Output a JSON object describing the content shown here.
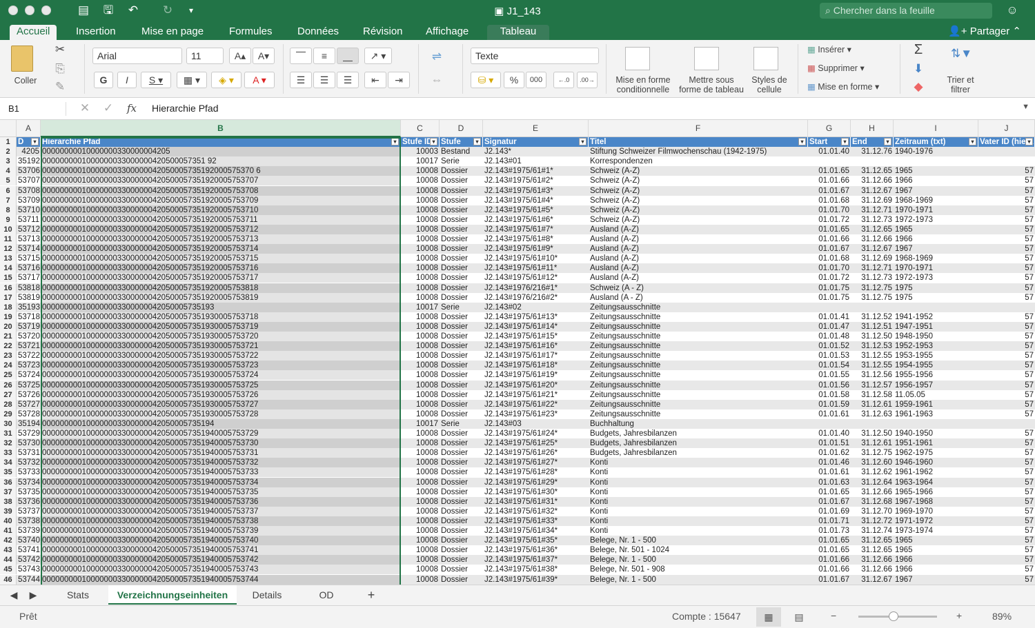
{
  "window": {
    "title": "J1_143",
    "search_placeholder": "Chercher dans la feuille"
  },
  "ribbon_tabs": [
    "Accueil",
    "Insertion",
    "Mise en page",
    "Formules",
    "Données",
    "Révision",
    "Affichage",
    "Tableau"
  ],
  "share_label": "Partager",
  "ribbon": {
    "paste": "Coller",
    "font": "Arial",
    "size": "11",
    "number_format": "Texte",
    "conditional": [
      "Mise en forme",
      "conditionnelle"
    ],
    "table_format": [
      "Mettre sous",
      "forme de tableau"
    ],
    "cell_styles": [
      "Styles de",
      "cellule"
    ],
    "insert": "Insérer",
    "delete": "Supprimer",
    "format": "Mise en forme",
    "sort": [
      "Trier et",
      "filtrer"
    ]
  },
  "formula_bar": {
    "cell_ref": "B1",
    "fx": "fx",
    "value": "Hierarchie Pfad"
  },
  "columns": [
    "A",
    "B",
    "C",
    "D",
    "E",
    "F",
    "G",
    "H",
    "I",
    "J"
  ],
  "headers": [
    "D",
    "Hierarchie Pfad",
    "Stufe ID",
    "Stufe",
    "Signatur",
    "Titel",
    "Start",
    "End",
    "Zeitraum (txt)",
    "Vater ID (hiera"
  ],
  "rows": [
    [
      "4205",
      "00000000010000000330000004205",
      "10003",
      "Bestand",
      "J2.143*",
      "Stiftung Schweizer Filmwochenschau (1942-1975)",
      "01.01.40",
      "31.12.76",
      "1940-1976",
      ""
    ],
    [
      "35192",
      "0000000001000000033000000420500057351 92",
      "10017",
      "Serie",
      "J2.143#01",
      "Korrespondenzen",
      "",
      "",
      "",
      ""
    ],
    [
      "53706",
      "000000000100000003300000042050005735192000575370 6",
      "10008",
      "Dossier",
      "J2.143#1975/61#1*",
      "Schweiz (A-Z)",
      "01.01.65",
      "31.12.65",
      "1965",
      "57"
    ],
    [
      "53707",
      "0000000001000000033000000420500057351920005753707",
      "10008",
      "Dossier",
      "J2.143#1975/61#2*",
      "Schweiz (A-Z)",
      "01.01.66",
      "31.12.66",
      "1966",
      "57"
    ],
    [
      "53708",
      "0000000001000000033000000420500057351920005753708",
      "10008",
      "Dossier",
      "J2.143#1975/61#3*",
      "Schweiz (A-Z)",
      "01.01.67",
      "31.12.67",
      "1967",
      "57"
    ],
    [
      "53709",
      "0000000001000000033000000420500057351920005753709",
      "10008",
      "Dossier",
      "J2.143#1975/61#4*",
      "Schweiz (A-Z)",
      "01.01.68",
      "31.12.69",
      "1968-1969",
      "57"
    ],
    [
      "53710",
      "0000000001000000033000000420500057351920005753710",
      "10008",
      "Dossier",
      "J2.143#1975/61#5*",
      "Schweiz (A-Z)",
      "01.01.70",
      "31.12.71",
      "1970-1971",
      "57"
    ],
    [
      "53711",
      "0000000001000000033000000420500057351920005753711",
      "10008",
      "Dossier",
      "J2.143#1975/61#6*",
      "Schweiz (A-Z)",
      "01.01.72",
      "31.12.73",
      "1972-1973",
      "57"
    ],
    [
      "53712",
      "0000000001000000033000000420500057351920005753712",
      "10008",
      "Dossier",
      "J2.143#1975/61#7*",
      "Ausland (A-Z)",
      "01.01.65",
      "31.12.65",
      "1965",
      "57"
    ],
    [
      "53713",
      "0000000001000000033000000420500057351920005753713",
      "10008",
      "Dossier",
      "J2.143#1975/61#8*",
      "Ausland (A-Z)",
      "01.01.66",
      "31.12.66",
      "1966",
      "57"
    ],
    [
      "53714",
      "0000000001000000033000000420500057351920005753714",
      "10008",
      "Dossier",
      "J2.143#1975/61#9*",
      "Ausland (A-Z)",
      "01.01.67",
      "31.12.67",
      "1967",
      "57"
    ],
    [
      "53715",
      "0000000001000000033000000420500057351920005753715",
      "10008",
      "Dossier",
      "J2.143#1975/61#10*",
      "Ausland (A-Z)",
      "01.01.68",
      "31.12.69",
      "1968-1969",
      "57"
    ],
    [
      "53716",
      "0000000001000000033000000420500057351920005753716",
      "10008",
      "Dossier",
      "J2.143#1975/61#11*",
      "Ausland (A-Z)",
      "01.01.70",
      "31.12.71",
      "1970-1971",
      "57"
    ],
    [
      "53717",
      "0000000001000000033000000420500057351920005753717",
      "10008",
      "Dossier",
      "J2.143#1975/61#12*",
      "Ausland (A-Z)",
      "01.01.72",
      "31.12.73",
      "1972-1973",
      "57"
    ],
    [
      "53818",
      "0000000001000000033000000420500057351920005753818",
      "10008",
      "Dossier",
      "J2.143#1976/216#1*",
      "Schweiz (A - Z)",
      "01.01.75",
      "31.12.75",
      "1975",
      "57"
    ],
    [
      "53819",
      "0000000001000000033000000420500057351920005753819",
      "10008",
      "Dossier",
      "J2.143#1976/216#2*",
      "Ausland (A - Z)",
      "01.01.75",
      "31.12.75",
      "1975",
      "57"
    ],
    [
      "35193",
      "000000000100000003300000042050005735193",
      "10017",
      "Serie",
      "J2.143#02",
      "Zeitungsausschnitte",
      "",
      "",
      "",
      ""
    ],
    [
      "53718",
      "0000000001000000033000000420500057351930005753718",
      "10008",
      "Dossier",
      "J2.143#1975/61#13*",
      "Zeitungsausschnitte",
      "01.01.41",
      "31.12.52",
      "1941-1952",
      "57"
    ],
    [
      "53719",
      "0000000001000000033000000420500057351930005753719",
      "10008",
      "Dossier",
      "J2.143#1975/61#14*",
      "Zeitungsausschnitte",
      "01.01.47",
      "31.12.51",
      "1947-1951",
      "57"
    ],
    [
      "53720",
      "0000000001000000033000000420500057351930005753720",
      "10008",
      "Dossier",
      "J2.143#1975/61#15*",
      "Zeitungsausschnitte",
      "01.01.48",
      "31.12.50",
      "1948-1950",
      "57"
    ],
    [
      "53721",
      "0000000001000000033000000420500057351930005753721",
      "10008",
      "Dossier",
      "J2.143#1975/61#16*",
      "Zeitungsausschnitte",
      "01.01.52",
      "31.12.53",
      "1952-1953",
      "57"
    ],
    [
      "53722",
      "0000000001000000033000000420500057351930005753722",
      "10008",
      "Dossier",
      "J2.143#1975/61#17*",
      "Zeitungsausschnitte",
      "01.01.53",
      "31.12.55",
      "1953-1955",
      "57"
    ],
    [
      "53723",
      "0000000001000000033000000420500057351930005753723",
      "10008",
      "Dossier",
      "J2.143#1975/61#18*",
      "Zeitungsausschnitte",
      "01.01.54",
      "31.12.55",
      "1954-1955",
      "57"
    ],
    [
      "53724",
      "0000000001000000033000000420500057351930005753724",
      "10008",
      "Dossier",
      "J2.143#1975/61#19*",
      "Zeitungsausschnitte",
      "01.01.55",
      "31.12.56",
      "1955-1956",
      "57"
    ],
    [
      "53725",
      "0000000001000000033000000420500057351930005753725",
      "10008",
      "Dossier",
      "J2.143#1975/61#20*",
      "Zeitungsausschnitte",
      "01.01.56",
      "31.12.57",
      "1956-1957",
      "57"
    ],
    [
      "53726",
      "0000000001000000033000000420500057351930005753726",
      "10008",
      "Dossier",
      "J2.143#1975/61#21*",
      "Zeitungsausschnitte",
      "01.01.58",
      "31.12.58",
      "11.05.05",
      "57"
    ],
    [
      "53727",
      "0000000001000000033000000420500057351930005753727",
      "10008",
      "Dossier",
      "J2.143#1975/61#22*",
      "Zeitungsausschnitte",
      "01.01.59",
      "31.12.61",
      "1959-1961",
      "57"
    ],
    [
      "53728",
      "0000000001000000033000000420500057351930005753728",
      "10008",
      "Dossier",
      "J2.143#1975/61#23*",
      "Zeitungsausschnitte",
      "01.01.61",
      "31.12.63",
      "1961-1963",
      "57"
    ],
    [
      "35194",
      "000000000100000003300000042050005735194",
      "10017",
      "Serie",
      "J2.143#03",
      "Buchhaltung",
      "",
      "",
      "",
      ""
    ],
    [
      "53729",
      "0000000001000000033000000420500057351940005753729",
      "10008",
      "Dossier",
      "J2.143#1975/61#24*",
      "Budgets, Jahresbilanzen",
      "01.01.40",
      "31.12.50",
      "1940-1950",
      "57"
    ],
    [
      "53730",
      "0000000001000000033000000420500057351940005753730",
      "10008",
      "Dossier",
      "J2.143#1975/61#25*",
      "Budgets, Jahresbilanzen",
      "01.01.51",
      "31.12.61",
      "1951-1961",
      "57"
    ],
    [
      "53731",
      "0000000001000000033000000420500057351940005753731",
      "10008",
      "Dossier",
      "J2.143#1975/61#26*",
      "Budgets, Jahresbilanzen",
      "01.01.62",
      "31.12.75",
      "1962-1975",
      "57"
    ],
    [
      "53732",
      "0000000001000000033000000420500057351940005753732",
      "10008",
      "Dossier",
      "J2.143#1975/61#27*",
      "Konti",
      "01.01.46",
      "31.12.60",
      "1946-1960",
      "57"
    ],
    [
      "53733",
      "0000000001000000033000000420500057351940005753733",
      "10008",
      "Dossier",
      "J2.143#1975/61#28*",
      "Konti",
      "01.01.61",
      "31.12.62",
      "1961-1962",
      "57"
    ],
    [
      "53734",
      "0000000001000000033000000420500057351940005753734",
      "10008",
      "Dossier",
      "J2.143#1975/61#29*",
      "Konti",
      "01.01.63",
      "31.12.64",
      "1963-1964",
      "57"
    ],
    [
      "53735",
      "0000000001000000033000000420500057351940005753735",
      "10008",
      "Dossier",
      "J2.143#1975/61#30*",
      "Konti",
      "01.01.65",
      "31.12.66",
      "1965-1966",
      "57"
    ],
    [
      "53736",
      "0000000001000000033000000420500057351940005753736",
      "10008",
      "Dossier",
      "J2.143#1975/61#31*",
      "Konti",
      "01.01.67",
      "31.12.68",
      "1967-1968",
      "57"
    ],
    [
      "53737",
      "0000000001000000033000000420500057351940005753737",
      "10008",
      "Dossier",
      "J2.143#1975/61#32*",
      "Konti",
      "01.01.69",
      "31.12.70",
      "1969-1970",
      "57"
    ],
    [
      "53738",
      "0000000001000000033000000420500057351940005753738",
      "10008",
      "Dossier",
      "J2.143#1975/61#33*",
      "Konti",
      "01.01.71",
      "31.12.72",
      "1971-1972",
      "57"
    ],
    [
      "53739",
      "0000000001000000033000000420500057351940005753739",
      "10008",
      "Dossier",
      "J2.143#1975/61#34*",
      "Konti",
      "01.01.73",
      "31.12.74",
      "1973-1974",
      "57"
    ],
    [
      "53740",
      "0000000001000000033000000420500057351940005753740",
      "10008",
      "Dossier",
      "J2.143#1975/61#35*",
      "Belege, Nr. 1 - 500",
      "01.01.65",
      "31.12.65",
      "1965",
      "57"
    ],
    [
      "53741",
      "0000000001000000033000000420500057351940005753741",
      "10008",
      "Dossier",
      "J2.143#1975/61#36*",
      "Belege, Nr. 501 - 1024",
      "01.01.65",
      "31.12.65",
      "1965",
      "57"
    ],
    [
      "53742",
      "0000000001000000033000000420500057351940005753742",
      "10008",
      "Dossier",
      "J2.143#1975/61#37*",
      "Belege, Nr. 1 - 500",
      "01.01.66",
      "31.12.66",
      "1966",
      "57"
    ],
    [
      "53743",
      "0000000001000000033000000420500057351940005753743",
      "10008",
      "Dossier",
      "J2.143#1975/61#38*",
      "Belege, Nr. 501 - 908",
      "01.01.66",
      "31.12.66",
      "1966",
      "57"
    ],
    [
      "53744",
      "0000000001000000033000000420500057351940005753744",
      "10008",
      "Dossier",
      "J2.143#1975/61#39*",
      "Belege, Nr. 1 - 500",
      "01.01.67",
      "31.12.67",
      "1967",
      "57"
    ]
  ],
  "sheets": [
    "Stats",
    "Verzeichnungseinheiten",
    "Details",
    "OD"
  ],
  "active_sheet": 1,
  "status": {
    "ready": "Prêt",
    "count": "Compte : 15647",
    "zoom": "89%"
  },
  "colors": {
    "accent": "#227447",
    "table_header": "#4a86c8",
    "stripe": "#dcdcdc"
  }
}
